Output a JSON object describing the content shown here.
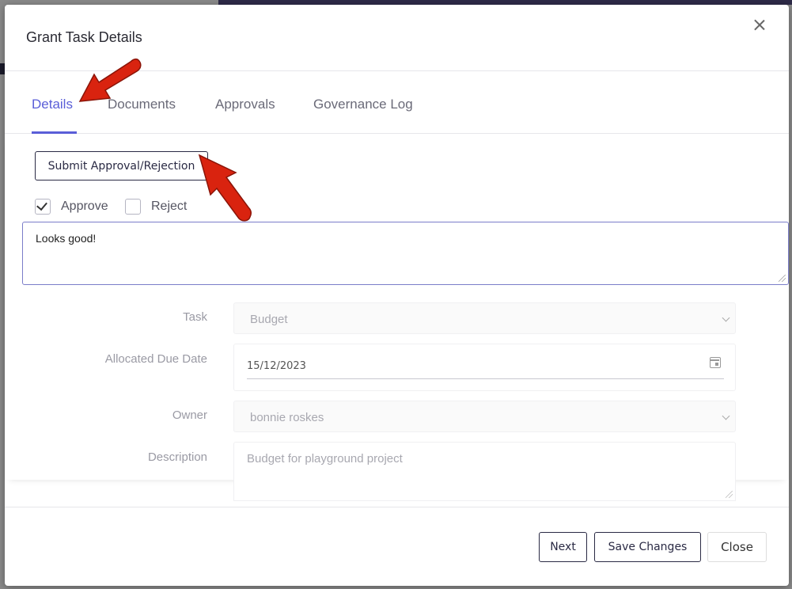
{
  "modal": {
    "title": "Grant Task Details"
  },
  "tabs": [
    {
      "label": "Details",
      "active": true
    },
    {
      "label": "Documents",
      "active": false
    },
    {
      "label": "Approvals",
      "active": false
    },
    {
      "label": "Governance Log",
      "active": false
    }
  ],
  "approval": {
    "submit_label": "Submit Approval/Rejection",
    "approve_label": "Approve",
    "approve_checked": true,
    "reject_label": "Reject",
    "reject_checked": false,
    "comment": "Looks good!"
  },
  "form": {
    "task_label": "Task",
    "task_value": "Budget",
    "due_label": "Allocated Due Date",
    "due_value": "15/12/2023",
    "owner_label": "Owner",
    "owner_value": "bonnie roskes",
    "description_label": "Description",
    "description_value": "Budget for playground project"
  },
  "footer": {
    "next_label": "Next",
    "save_label": "Save Changes",
    "close_label": "Close"
  },
  "annotation_color": "#d9230f"
}
